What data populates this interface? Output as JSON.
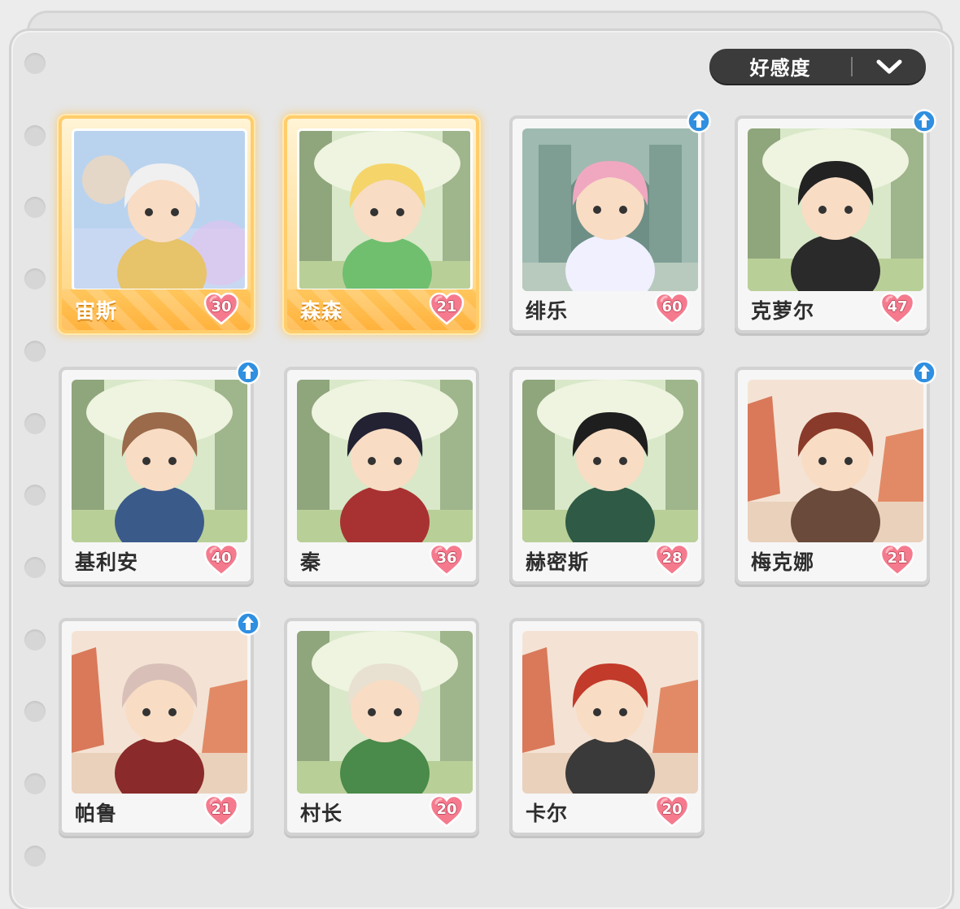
{
  "sort": {
    "label": "好感度",
    "icon": "chevron-down-icon"
  },
  "colors": {
    "heart": "#f57a8e",
    "upgrade": "#2f8fe0",
    "featured": "#ffbf4d"
  },
  "characters": [
    {
      "name": "宙斯",
      "affinity": "30",
      "featured": true,
      "upgrade": false,
      "bg": "sky"
    },
    {
      "name": "森森",
      "affinity": "21",
      "featured": true,
      "upgrade": false,
      "bg": "forest"
    },
    {
      "name": "绯乐",
      "affinity": "60",
      "featured": false,
      "upgrade": true,
      "bg": "ruins"
    },
    {
      "name": "克萝尔",
      "affinity": "47",
      "featured": false,
      "upgrade": true,
      "bg": "forest"
    },
    {
      "name": "基利安",
      "affinity": "40",
      "featured": false,
      "upgrade": true,
      "bg": "forest"
    },
    {
      "name": "秦",
      "affinity": "36",
      "featured": false,
      "upgrade": false,
      "bg": "forest"
    },
    {
      "name": "赫密斯",
      "affinity": "28",
      "featured": false,
      "upgrade": false,
      "bg": "forest"
    },
    {
      "name": "梅克娜",
      "affinity": "21",
      "featured": false,
      "upgrade": true,
      "bg": "canyon"
    },
    {
      "name": "帕鲁",
      "affinity": "21",
      "featured": false,
      "upgrade": true,
      "bg": "canyon"
    },
    {
      "name": "村长",
      "affinity": "20",
      "featured": false,
      "upgrade": false,
      "bg": "forest"
    },
    {
      "name": "卡尔",
      "affinity": "20",
      "featured": false,
      "upgrade": false,
      "bg": "canyon"
    }
  ]
}
